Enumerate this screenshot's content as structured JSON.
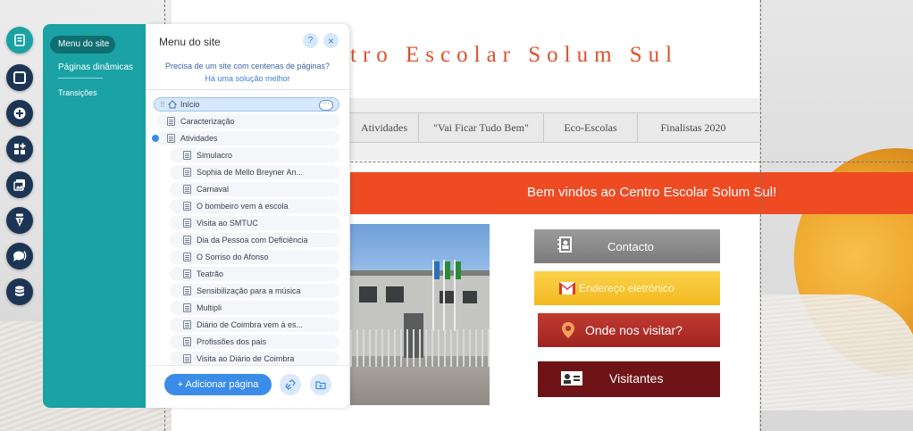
{
  "site": {
    "title": "tro Escolar Solum Sul",
    "nav": [
      "Atividades",
      "\"Vai Ficar Tudo Bem\"",
      "Eco-Escolas",
      "Finalistas 2020"
    ],
    "welcome": "Bem vindos ao Centro Escolar Solum Sul!",
    "buttons": [
      {
        "label": "Contacto",
        "icon": "contact-book-icon",
        "color": "#8a8a8a"
      },
      {
        "label": "Endereço eletrónico",
        "icon": "gmail-icon",
        "color": "#f6c42e"
      },
      {
        "label": "Onde nos visitar?",
        "icon": "location-pin-icon",
        "color": "#b3312a"
      },
      {
        "label": "Visitantes",
        "icon": "visitors-card-icon",
        "color": "#6e1416"
      }
    ]
  },
  "iconbar": [
    {
      "name": "pages-menu-icon",
      "active": true
    },
    {
      "name": "background-icon"
    },
    {
      "name": "add-icon"
    },
    {
      "name": "add-apps-icon"
    },
    {
      "name": "media-icon"
    },
    {
      "name": "blog-pen-icon"
    },
    {
      "name": "chat-icon"
    },
    {
      "name": "database-icon"
    }
  ],
  "teal_panel": {
    "items": [
      "Menu do site",
      "Páginas dinâmicas",
      "Transições"
    ]
  },
  "pages_panel": {
    "title": "Menu do site",
    "help": "?",
    "close": "×",
    "info_line1": "Precisa de um site com centenas de páginas?",
    "info_line2": "Há uma solução melhor",
    "pages": [
      {
        "label": "Início",
        "level": 0,
        "home": true,
        "selected": true
      },
      {
        "label": "Caracterização",
        "level": 0
      },
      {
        "label": "Atividades",
        "level": 0,
        "expanded": true
      },
      {
        "label": "Simulacro",
        "level": 1
      },
      {
        "label": "Sophia de Mello Breyner An...",
        "level": 1
      },
      {
        "label": "Carnaval",
        "level": 1
      },
      {
        "label": "O bombeiro vem à escola",
        "level": 1
      },
      {
        "label": "Visita ao SMTUC",
        "level": 1
      },
      {
        "label": "Dia da Pessoa com Deficiência",
        "level": 1
      },
      {
        "label": "O Sorriso do Afonso",
        "level": 1
      },
      {
        "label": "Teatrão",
        "level": 1
      },
      {
        "label": "Sensibilização para a música",
        "level": 1
      },
      {
        "label": "Multipli",
        "level": 1
      },
      {
        "label": "Diário de Coimbra vem à es...",
        "level": 1
      },
      {
        "label": "Profissões dos pais",
        "level": 1
      },
      {
        "label": "Visita ao Diário de Coimbra",
        "level": 1
      }
    ],
    "add_button": "+ Adicionar página"
  }
}
